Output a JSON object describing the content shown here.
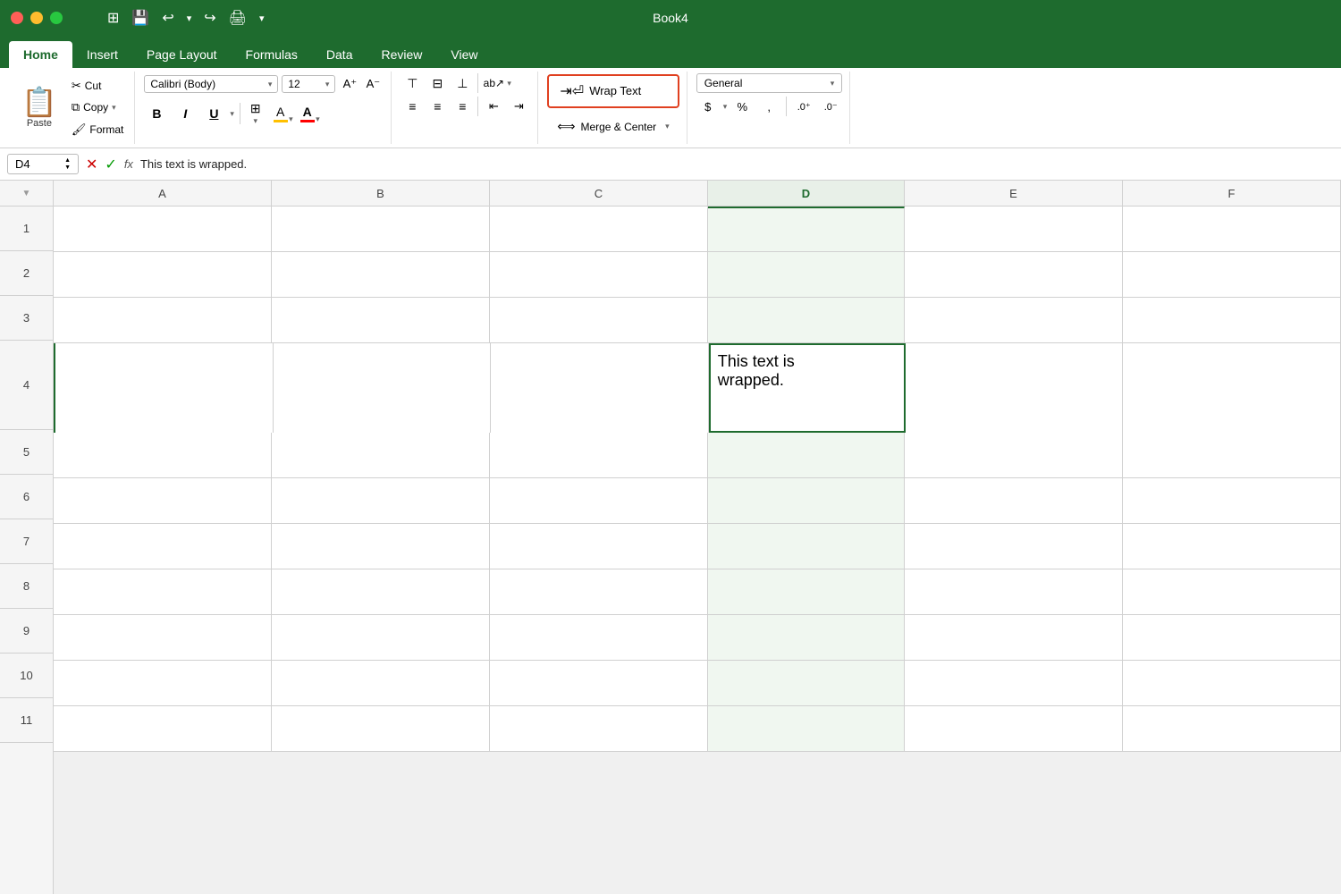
{
  "app": {
    "title": "Book4",
    "window_controls": {
      "close": "●",
      "minimize": "●",
      "maximize": "●"
    }
  },
  "ribbon": {
    "tabs": [
      {
        "label": "Home",
        "active": true
      },
      {
        "label": "Insert",
        "active": false
      },
      {
        "label": "Page Layout",
        "active": false
      },
      {
        "label": "Formulas",
        "active": false
      },
      {
        "label": "Data",
        "active": false
      },
      {
        "label": "Review",
        "active": false
      },
      {
        "label": "View",
        "active": false
      }
    ],
    "clipboard": {
      "paste_label": "Paste",
      "cut_label": "Cut",
      "copy_label": "Copy",
      "format_label": "Format"
    },
    "font": {
      "family": "Calibri (Body)",
      "size": "12",
      "bold_label": "B",
      "italic_label": "I",
      "underline_label": "U"
    },
    "alignment": {
      "wrap_text_label": "Wrap Text",
      "merge_center_label": "Merge & Center"
    },
    "number": {
      "format": "General"
    }
  },
  "formula_bar": {
    "cell_ref": "D4",
    "fx_symbol": "fx",
    "formula": "This text is wrapped."
  },
  "spreadsheet": {
    "columns": [
      "A",
      "B",
      "C",
      "D",
      "E",
      "F"
    ],
    "rows": [
      1,
      2,
      3,
      4,
      5,
      6,
      7,
      8,
      9,
      10,
      11
    ],
    "selected_cell": {
      "row": 4,
      "col": "D"
    },
    "cells": {
      "D4": {
        "value": "This text is wrapped.",
        "wrapped": true
      }
    }
  }
}
